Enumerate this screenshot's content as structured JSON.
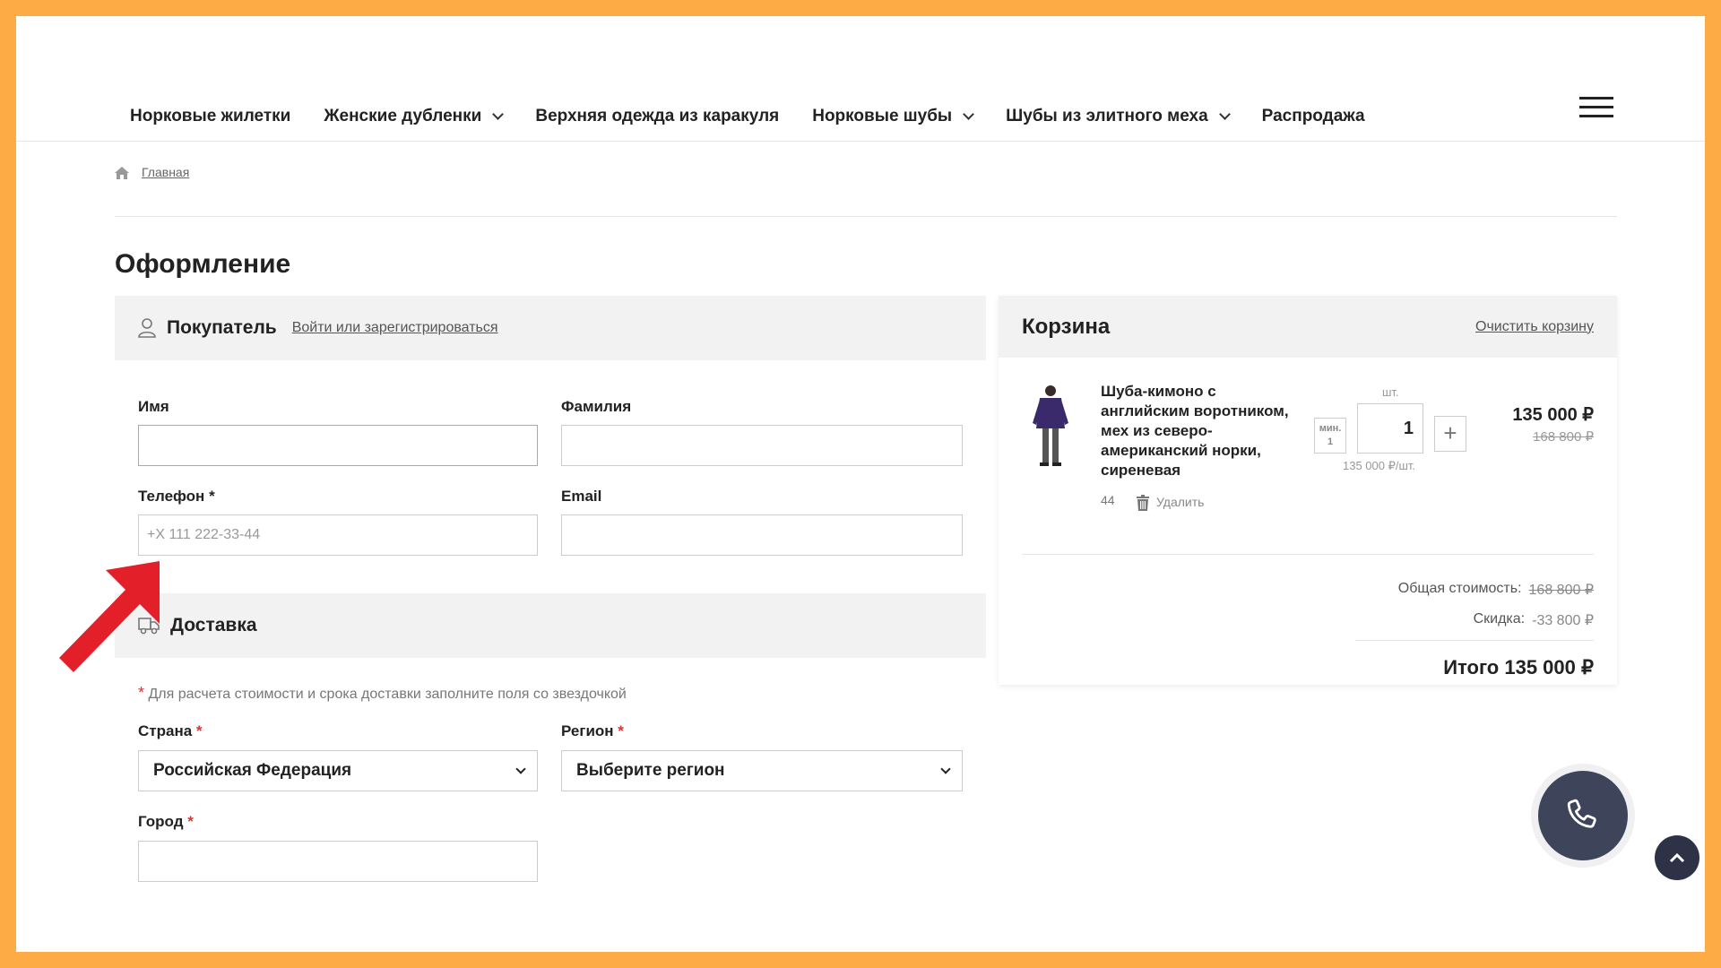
{
  "nav": {
    "items": [
      {
        "label": "Норковые жилетки",
        "dropdown": false
      },
      {
        "label": "Женские дубленки",
        "dropdown": true
      },
      {
        "label": "Верхняя одежда из каракуля",
        "dropdown": false
      },
      {
        "label": "Норковые шубы",
        "dropdown": true
      },
      {
        "label": "Шубы из элитного меха",
        "dropdown": true
      },
      {
        "label": "Распродажа",
        "dropdown": false
      }
    ],
    "menu_icon": "hamburger-icon"
  },
  "breadcrumb": {
    "home_icon": "home-icon",
    "items": [
      "Главная"
    ]
  },
  "page": {
    "title": "Оформление"
  },
  "buyer": {
    "title": "Покупатель",
    "login_link": "Войти или зарегистрироваться",
    "fields": {
      "first_name_label": "Имя",
      "first_name_value": "",
      "last_name_label": "Фамилия",
      "last_name_value": "",
      "phone_label": "Телефон",
      "phone_required": "*",
      "phone_placeholder": "+X 111 222-33-44",
      "email_label": "Email",
      "email_value": ""
    }
  },
  "delivery": {
    "title": "Доставка",
    "hint_star": "*",
    "hint": "Для расчета стоимости и срока доставки заполните поля со звездочкой",
    "country_label": "Страна",
    "country_value": "Российская Федерация",
    "region_label": "Регион",
    "region_value": "Выберите регион",
    "city_label": "Город",
    "city_value": "",
    "required_mark": "*"
  },
  "cart": {
    "title": "Корзина",
    "clear_link": "Очистить корзину",
    "item": {
      "name": "Шуба-кимоно с английским воротником, мех из северо-американский норки, сиреневая",
      "size": "44",
      "delete_label": "Удалить",
      "unit_label": "шт.",
      "min_label": "мин.",
      "min_value": "1",
      "quantity": "1",
      "plus_label": "+",
      "unit_price": "135 000 ₽/шт.",
      "price": "135 000 ₽",
      "old_price": "168 800 ₽"
    },
    "summary": {
      "total_cost_label": "Общая стоимость:",
      "total_cost_value": "168 800 ₽",
      "discount_label": "Скидка:",
      "discount_value": "-33 800 ₽",
      "total_label": "Итого 135 000 ₽"
    }
  },
  "floating": {
    "call_icon": "phone-icon",
    "up_icon": "chevron-up-icon"
  },
  "colors": {
    "border_frame": "#fdab45",
    "accent_red": "#e3202a",
    "call_button": "#3e4459"
  }
}
